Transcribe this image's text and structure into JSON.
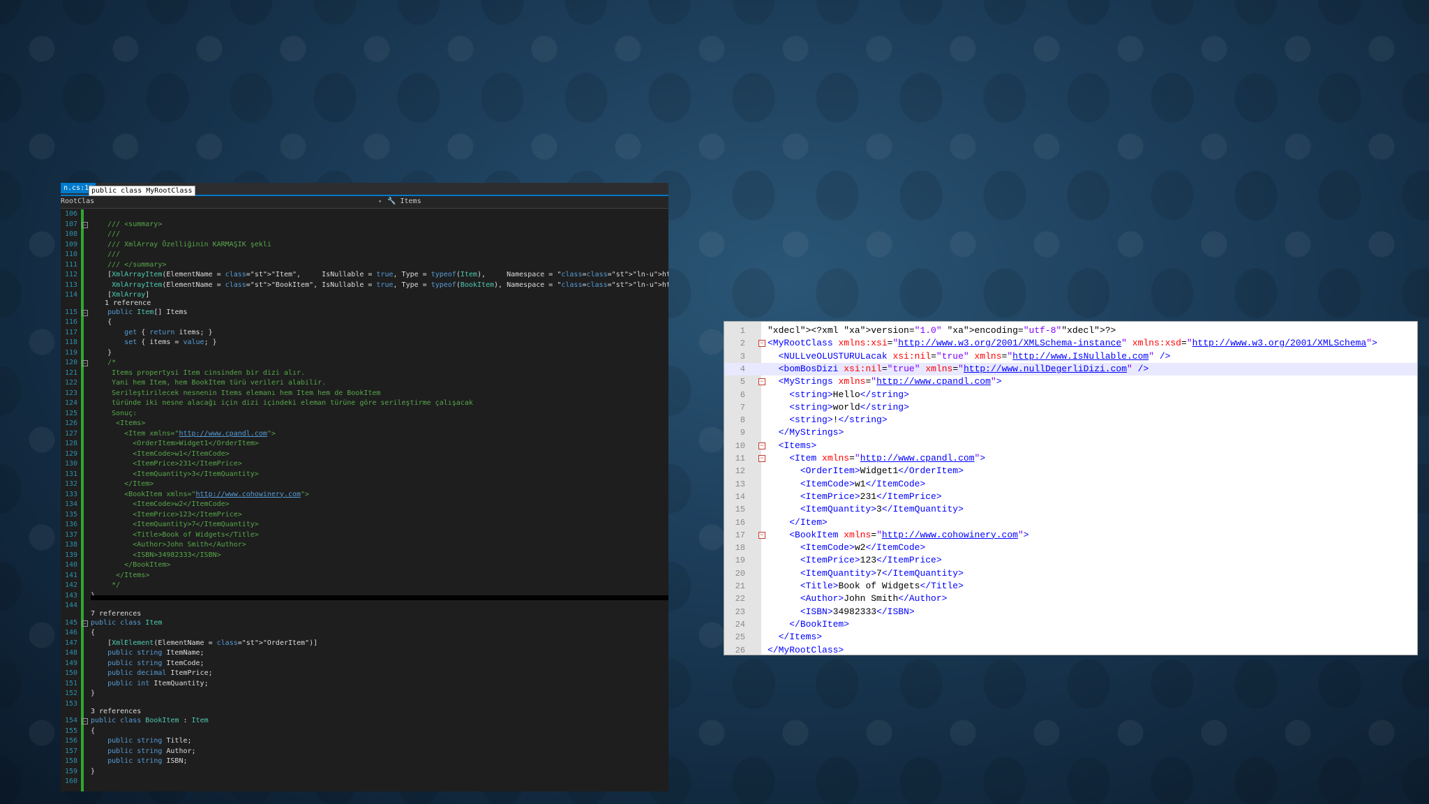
{
  "vs": {
    "tab_label": "n.cs:1*",
    "tooltip": "public class MyRootClass",
    "nav_left": "RootClas",
    "nav_right": "Items",
    "lines": [
      {
        "n": "106",
        "t": ""
      },
      {
        "n": "107",
        "t": "    /// <summary>"
      },
      {
        "n": "108",
        "t": "    ///"
      },
      {
        "n": "109",
        "t": "    /// XmlArray Özelliğinin KARMAŞIK şekli"
      },
      {
        "n": "110",
        "t": "    ///"
      },
      {
        "n": "111",
        "t": "    /// </summary>"
      },
      {
        "n": "112",
        "t": "    [XmlArrayItem(ElementName = \"Item\",     IsNullable = true, Type = typeof(Item),     Namespace = \"http://www.cpandl.com\"),"
      },
      {
        "n": "113",
        "t": "     XmlArrayItem(ElementName = \"BookItem\", IsNullable = true, Type = typeof(BookItem), Namespace = \"http://www.cohowinery.com\")]"
      },
      {
        "n": "114",
        "t": "    [XmlArray]"
      },
      {
        "n": "115",
        "t": "    public Item[] Items"
      },
      {
        "n": "116",
        "t": "    {"
      },
      {
        "n": "117",
        "t": "        get { return items; }"
      },
      {
        "n": "118",
        "t": "        set { items = value; }"
      },
      {
        "n": "119",
        "t": "    }"
      },
      {
        "n": "120",
        "t": "    /*"
      },
      {
        "n": "121",
        "t": "     Items propertysi Item cinsinden bir dizi alır."
      },
      {
        "n": "122",
        "t": "     Yani hem Item, hem BookItem türü verileri alabilir."
      },
      {
        "n": "123",
        "t": "     Serileştirilecek nesnenin Items elemanı hem Item hem de BookItem"
      },
      {
        "n": "124",
        "t": "     türünde iki nesne alacağı için dizi içindeki eleman türüne göre serileştirme çalışacak"
      },
      {
        "n": "125",
        "t": "     Sonuç:"
      },
      {
        "n": "126",
        "t": "      <Items>"
      },
      {
        "n": "127",
        "t": "        <Item xmlns=\"http://www.cpandl.com\">"
      },
      {
        "n": "128",
        "t": "          <OrderItem>Widget1</OrderItem>"
      },
      {
        "n": "129",
        "t": "          <ItemCode>w1</ItemCode>"
      },
      {
        "n": "130",
        "t": "          <ItemPrice>231</ItemPrice>"
      },
      {
        "n": "131",
        "t": "          <ItemQuantity>3</ItemQuantity>"
      },
      {
        "n": "132",
        "t": "        </Item>"
      },
      {
        "n": "133",
        "t": "        <BookItem xmlns=\"http://www.cohowinery.com\">"
      },
      {
        "n": "134",
        "t": "          <ItemCode>w2</ItemCode>"
      },
      {
        "n": "135",
        "t": "          <ItemPrice>123</ItemPrice>"
      },
      {
        "n": "136",
        "t": "          <ItemQuantity>7</ItemQuantity>"
      },
      {
        "n": "137",
        "t": "          <Title>Book of Widgets</Title>"
      },
      {
        "n": "138",
        "t": "          <Author>John Smith</Author>"
      },
      {
        "n": "139",
        "t": "          <ISBN>34982333</ISBN>"
      },
      {
        "n": "140",
        "t": "        </BookItem>"
      },
      {
        "n": "141",
        "t": "      </Items>"
      },
      {
        "n": "142",
        "t": "     */"
      },
      {
        "n": "143",
        "t": "}"
      },
      {
        "n": "144",
        "t": ""
      },
      {
        "n": "145",
        "t": "public class Item"
      },
      {
        "n": "146",
        "t": "{"
      },
      {
        "n": "147",
        "t": "    [XmlElement(ElementName = \"OrderItem\")]"
      },
      {
        "n": "148",
        "t": "    public string ItemName;"
      },
      {
        "n": "149",
        "t": "    public string ItemCode;"
      },
      {
        "n": "150",
        "t": "    public decimal ItemPrice;"
      },
      {
        "n": "151",
        "t": "    public int ItemQuantity;"
      },
      {
        "n": "152",
        "t": "}"
      },
      {
        "n": "153",
        "t": ""
      },
      {
        "n": "154",
        "t": "public class BookItem : Item"
      },
      {
        "n": "155",
        "t": "{"
      },
      {
        "n": "156",
        "t": "    public string Title;"
      },
      {
        "n": "157",
        "t": "    public string Author;"
      },
      {
        "n": "158",
        "t": "    public string ISBN;"
      },
      {
        "n": "159",
        "t": "}"
      },
      {
        "n": "160",
        "t": ""
      }
    ],
    "ref_1": "1 reference",
    "ref_7": "7 references",
    "ref_3": "3 references"
  },
  "xml": {
    "lines": [
      {
        "n": "1",
        "t": "<?xml version=\"1.0\" encoding=\"utf-8\"?>"
      },
      {
        "n": "2",
        "t": "<MyRootClass xmlns:xsi=\"http://www.w3.org/2001/XMLSchema-instance\" xmlns:xsd=\"http://www.w3.org/2001/XMLSchema\">"
      },
      {
        "n": "3",
        "t": "  <NULLveOLUSTURULacak xsi:nil=\"true\" xmlns=\"http://www.IsNullable.com\" />"
      },
      {
        "n": "4",
        "t": "  <bomBosDizi xsi:nil=\"true\" xmlns=\"http://www.nullDegerliDizi.com\" />"
      },
      {
        "n": "5",
        "t": "  <MyStrings xmlns=\"http://www.cpandl.com\">"
      },
      {
        "n": "6",
        "t": "    <string>Hello</string>"
      },
      {
        "n": "7",
        "t": "    <string>world</string>"
      },
      {
        "n": "8",
        "t": "    <string>!</string>"
      },
      {
        "n": "9",
        "t": "  </MyStrings>"
      },
      {
        "n": "10",
        "t": "  <Items>"
      },
      {
        "n": "11",
        "t": "    <Item xmlns=\"http://www.cpandl.com\">"
      },
      {
        "n": "12",
        "t": "      <OrderItem>Widget1</OrderItem>"
      },
      {
        "n": "13",
        "t": "      <ItemCode>w1</ItemCode>"
      },
      {
        "n": "14",
        "t": "      <ItemPrice>231</ItemPrice>"
      },
      {
        "n": "15",
        "t": "      <ItemQuantity>3</ItemQuantity>"
      },
      {
        "n": "16",
        "t": "    </Item>"
      },
      {
        "n": "17",
        "t": "    <BookItem xmlns=\"http://www.cohowinery.com\">"
      },
      {
        "n": "18",
        "t": "      <ItemCode>w2</ItemCode>"
      },
      {
        "n": "19",
        "t": "      <ItemPrice>123</ItemPrice>"
      },
      {
        "n": "20",
        "t": "      <ItemQuantity>7</ItemQuantity>"
      },
      {
        "n": "21",
        "t": "      <Title>Book of Widgets</Title>"
      },
      {
        "n": "22",
        "t": "      <Author>John Smith</Author>"
      },
      {
        "n": "23",
        "t": "      <ISBN>34982333</ISBN>"
      },
      {
        "n": "24",
        "t": "    </BookItem>"
      },
      {
        "n": "25",
        "t": "  </Items>"
      },
      {
        "n": "26",
        "t": "</MyRootClass>"
      }
    ]
  },
  "colors": {
    "vs_bg": "#1e1e1e",
    "vs_accent": "#007acc",
    "change_bar": "#2fa82f",
    "xml_tag": "#0000ff",
    "xml_attr": "#ff0000",
    "xml_value": "#8000ff"
  }
}
